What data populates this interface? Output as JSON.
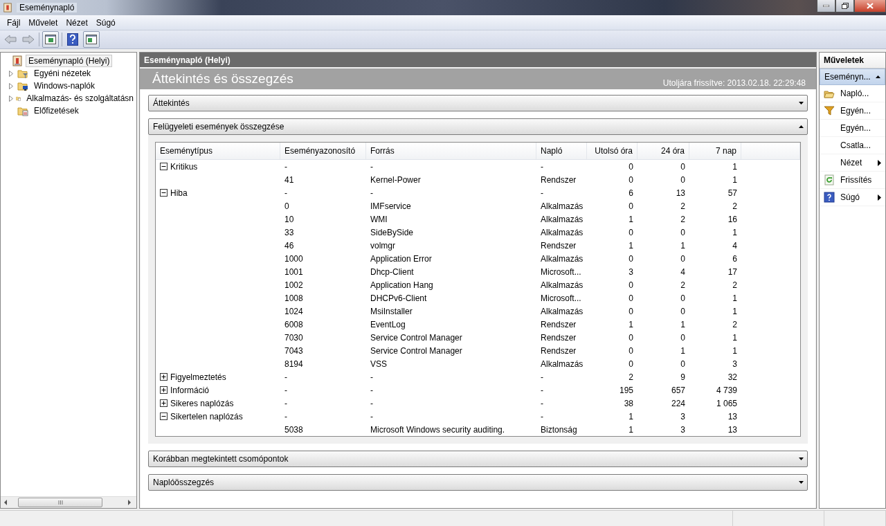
{
  "window": {
    "title": "Eseménynapló"
  },
  "menu": [
    "Fájl",
    "Művelet",
    "Nézet",
    "Súgó"
  ],
  "tree": [
    {
      "label": "Eseménynapló (Helyi)",
      "kind": "root",
      "selected": true,
      "children": [
        {
          "label": "Egyéni nézetek",
          "kind": "filter-folder",
          "selected": false,
          "expandable": true
        },
        {
          "label": "Windows-naplók",
          "kind": "computer-folder",
          "selected": false,
          "expandable": true
        },
        {
          "label": "Alkalmazás- és szolgáltatásn",
          "kind": "log-folder",
          "selected": false,
          "expandable": true
        },
        {
          "label": "Előfizetések",
          "kind": "calendar-folder",
          "selected": false,
          "expandable": false
        }
      ]
    }
  ],
  "main": {
    "header": "Eseménynapló (Helyi)",
    "title": "Áttekintés és összegzés",
    "updated": "Utoljára frissítve: 2013.02.18. 22:29:48"
  },
  "sections": [
    {
      "title": "Áttekintés",
      "expanded": false
    },
    {
      "title": "Felügyeleti események összegzése",
      "expanded": true,
      "table": {
        "columns": [
          "Eseménytípus",
          "Eseményazonosító",
          "Forrás",
          "Napló",
          "Utolsó óra",
          "24 óra",
          "7 nap"
        ],
        "rows": [
          {
            "kind": "group",
            "expanded": true,
            "type": "Kritikus",
            "id": "-",
            "source": "-",
            "log": "-",
            "hour": "0",
            "day": "0",
            "week": "1"
          },
          {
            "kind": "event",
            "id": "41",
            "source": "Kernel-Power",
            "log": "Rendszer",
            "hour": "0",
            "day": "0",
            "week": "1"
          },
          {
            "kind": "group",
            "expanded": true,
            "type": "Hiba",
            "id": "-",
            "source": "-",
            "log": "-",
            "hour": "6",
            "day": "13",
            "week": "57"
          },
          {
            "kind": "event",
            "id": "0",
            "source": "IMFservice",
            "log": "Alkalmazás",
            "hour": "0",
            "day": "2",
            "week": "2"
          },
          {
            "kind": "event",
            "id": "10",
            "source": "WMI",
            "log": "Alkalmazás",
            "hour": "1",
            "day": "2",
            "week": "16"
          },
          {
            "kind": "event",
            "id": "33",
            "source": "SideBySide",
            "log": "Alkalmazás",
            "hour": "0",
            "day": "0",
            "week": "1"
          },
          {
            "kind": "event",
            "id": "46",
            "source": "volmgr",
            "log": "Rendszer",
            "hour": "1",
            "day": "1",
            "week": "4"
          },
          {
            "kind": "event",
            "id": "1000",
            "source": "Application Error",
            "log": "Alkalmazás",
            "hour": "0",
            "day": "0",
            "week": "6"
          },
          {
            "kind": "event",
            "id": "1001",
            "source": "Dhcp-Client",
            "log": "Microsoft...",
            "hour": "3",
            "day": "4",
            "week": "17"
          },
          {
            "kind": "event",
            "id": "1002",
            "source": "Application Hang",
            "log": "Alkalmazás",
            "hour": "0",
            "day": "2",
            "week": "2"
          },
          {
            "kind": "event",
            "id": "1008",
            "source": "DHCPv6-Client",
            "log": "Microsoft...",
            "hour": "0",
            "day": "0",
            "week": "1"
          },
          {
            "kind": "event",
            "id": "1024",
            "source": "MsiInstaller",
            "log": "Alkalmazás",
            "hour": "0",
            "day": "0",
            "week": "1"
          },
          {
            "kind": "event",
            "id": "6008",
            "source": "EventLog",
            "log": "Rendszer",
            "hour": "1",
            "day": "1",
            "week": "2"
          },
          {
            "kind": "event",
            "id": "7030",
            "source": "Service Control Manager",
            "log": "Rendszer",
            "hour": "0",
            "day": "0",
            "week": "1"
          },
          {
            "kind": "event",
            "id": "7043",
            "source": "Service Control Manager",
            "log": "Rendszer",
            "hour": "0",
            "day": "1",
            "week": "1"
          },
          {
            "kind": "event",
            "id": "8194",
            "source": "VSS",
            "log": "Alkalmazás",
            "hour": "0",
            "day": "0",
            "week": "3"
          },
          {
            "kind": "group",
            "expanded": false,
            "type": "Figyelmeztetés",
            "id": "-",
            "source": "-",
            "log": "-",
            "hour": "2",
            "day": "9",
            "week": "32"
          },
          {
            "kind": "group",
            "expanded": false,
            "type": "Információ",
            "id": "-",
            "source": "-",
            "log": "-",
            "hour": "195",
            "day": "657",
            "week": "4 739"
          },
          {
            "kind": "group",
            "expanded": false,
            "type": "Sikeres naplózás",
            "id": "-",
            "source": "-",
            "log": "-",
            "hour": "38",
            "day": "224",
            "week": "1 065"
          },
          {
            "kind": "group",
            "expanded": true,
            "type": "Sikertelen naplózás",
            "id": "-",
            "source": "-",
            "log": "-",
            "hour": "1",
            "day": "3",
            "week": "13"
          },
          {
            "kind": "event",
            "id": "5038",
            "source": "Microsoft Windows security auditing.",
            "log": "Biztonság",
            "hour": "1",
            "day": "3",
            "week": "13"
          }
        ]
      }
    },
    {
      "title": "Korábban megtekintett csomópontok",
      "expanded": false
    },
    {
      "title": "Naplóösszegzés",
      "expanded": false
    }
  ],
  "actions": {
    "header": "Műveletek",
    "group": {
      "label": "Eseményn...",
      "expanded": true
    },
    "items": [
      {
        "label": "Napló...",
        "kind": "folder",
        "submenu": false
      },
      {
        "label": "Egyén...",
        "kind": "filter",
        "submenu": false
      },
      {
        "label": "Egyén...",
        "kind": "plain",
        "submenu": false
      },
      {
        "label": "Csatla...",
        "kind": "plain",
        "submenu": false
      },
      {
        "label": "Nézet",
        "kind": "plain",
        "submenu": true
      },
      {
        "label": "Frissítés",
        "kind": "refresh",
        "submenu": false
      },
      {
        "label": "Súgó",
        "kind": "help",
        "submenu": true
      }
    ]
  }
}
